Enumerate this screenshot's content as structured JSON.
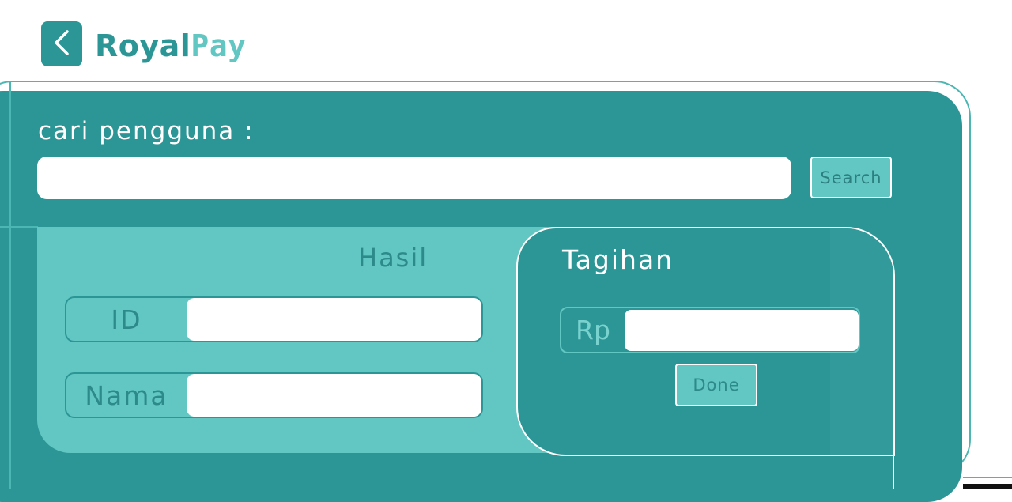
{
  "header": {
    "back_icon": "chevron-left-icon",
    "logo_royal": "Royal",
    "logo_pay": "Pay"
  },
  "search": {
    "label": "cari pengguna :",
    "value": "",
    "placeholder": "",
    "button_label": "Search"
  },
  "result": {
    "title": "Hasil",
    "id_label": "ID",
    "id_value": "",
    "name_label": "Nama",
    "name_value": ""
  },
  "bill": {
    "title": "Tagihan",
    "currency_label": "Rp",
    "amount_value": "",
    "done_label": "Done"
  },
  "colors": {
    "primary": "#2c9595",
    "accent": "#62c6c2",
    "white": "#ffffff"
  }
}
